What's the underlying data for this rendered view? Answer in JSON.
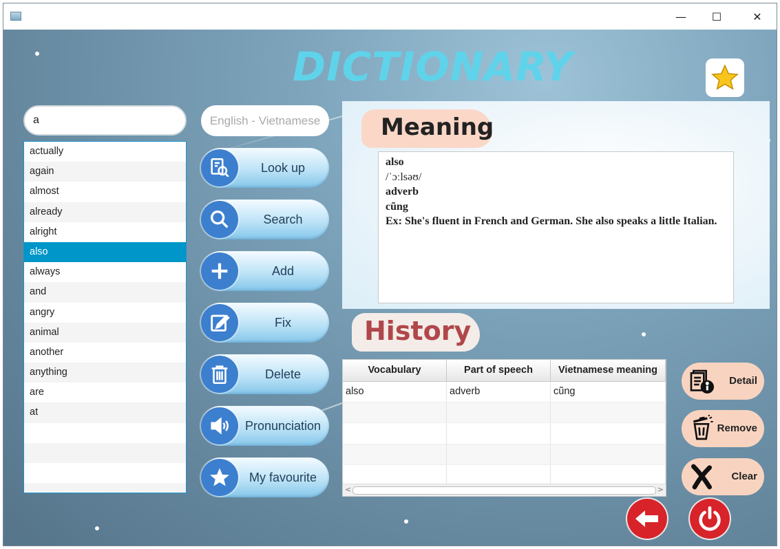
{
  "window": {
    "controls": {
      "minimize": "—",
      "maximize": "☐",
      "close": "✕"
    }
  },
  "app": {
    "title": "DICTIONARY"
  },
  "search": {
    "value": "a"
  },
  "language": {
    "selected": "English - Vietnamese"
  },
  "word_list": {
    "items": [
      "actually",
      "again",
      "almost",
      "already",
      "alright",
      "also",
      "always",
      "and",
      "angry",
      "animal",
      "another",
      "anything",
      "are",
      "at",
      "",
      "",
      "",
      ""
    ],
    "selected": "also"
  },
  "actions": {
    "lookup": "Look up",
    "search": "Search",
    "add": "Add",
    "fix": "Fix",
    "delete": "Delete",
    "pronunciation": "Pronunciation",
    "favourite": "My favourite"
  },
  "meaning": {
    "heading": "Meaning",
    "word": "also",
    "phonetic": "/ˈɔːlsəʊ/",
    "pos": "adverb",
    "vietnamese": "cũng",
    "example": "Ex: She's fluent in French and German. She also speaks a little Italian."
  },
  "history": {
    "heading": "History",
    "columns": [
      "Vocabulary",
      "Part of speech",
      "Vietnamese meaning"
    ],
    "rows": [
      [
        "also",
        "adverb",
        "cũng"
      ],
      [
        "",
        "",
        ""
      ],
      [
        "",
        "",
        ""
      ],
      [
        "",
        "",
        ""
      ],
      [
        "",
        "",
        ""
      ]
    ],
    "scroll": {
      "left": "<",
      "right": ">"
    }
  },
  "side_actions": {
    "detail": "Detail",
    "remove": "Remove",
    "clear": "Clear"
  },
  "colors": {
    "title": "#5fd3ea",
    "selection": "#0096c9",
    "action_icon": "#3c7fcf",
    "side_button": "#f8d4c0",
    "danger": "#d8232a"
  }
}
